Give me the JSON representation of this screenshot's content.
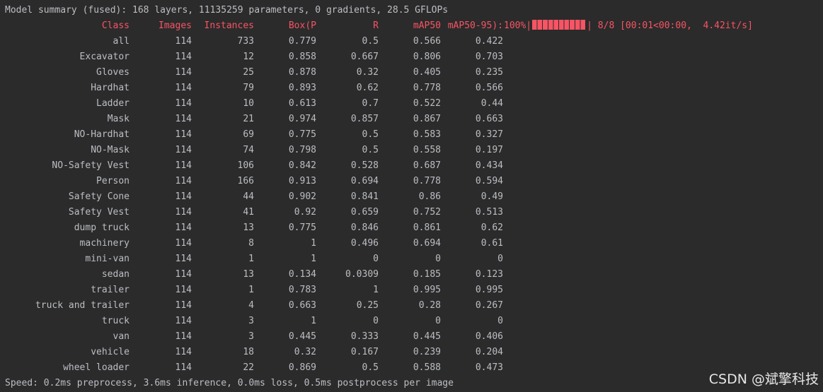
{
  "summary_line": "Model summary (fused): 168 layers, 11135259 parameters, 0 gradients, 28.5 GFLOPs",
  "header": {
    "class": "Class",
    "images": "Images",
    "instances": "Instances",
    "box_p": "Box(P",
    "r": "R",
    "map50": "mAP50",
    "map50_95": "mAP50-95):",
    "progress_pct": "100%|",
    "progress_fraction": 1.0,
    "progress_tail": "| 8/8 [00:01<00:00,  4.42it/s]"
  },
  "rows": [
    {
      "class": "all",
      "images": "114",
      "instances": "733",
      "p": "0.779",
      "r": "0.5",
      "map50": "0.566",
      "map50_95": "0.422"
    },
    {
      "class": "Excavator",
      "images": "114",
      "instances": "12",
      "p": "0.858",
      "r": "0.667",
      "map50": "0.806",
      "map50_95": "0.703"
    },
    {
      "class": "Gloves",
      "images": "114",
      "instances": "25",
      "p": "0.878",
      "r": "0.32",
      "map50": "0.405",
      "map50_95": "0.235"
    },
    {
      "class": "Hardhat",
      "images": "114",
      "instances": "79",
      "p": "0.893",
      "r": "0.62",
      "map50": "0.778",
      "map50_95": "0.566"
    },
    {
      "class": "Ladder",
      "images": "114",
      "instances": "10",
      "p": "0.613",
      "r": "0.7",
      "map50": "0.522",
      "map50_95": "0.44"
    },
    {
      "class": "Mask",
      "images": "114",
      "instances": "21",
      "p": "0.974",
      "r": "0.857",
      "map50": "0.867",
      "map50_95": "0.663"
    },
    {
      "class": "NO-Hardhat",
      "images": "114",
      "instances": "69",
      "p": "0.775",
      "r": "0.5",
      "map50": "0.583",
      "map50_95": "0.327"
    },
    {
      "class": "NO-Mask",
      "images": "114",
      "instances": "74",
      "p": "0.798",
      "r": "0.5",
      "map50": "0.558",
      "map50_95": "0.197"
    },
    {
      "class": "NO-Safety Vest",
      "images": "114",
      "instances": "106",
      "p": "0.842",
      "r": "0.528",
      "map50": "0.687",
      "map50_95": "0.434"
    },
    {
      "class": "Person",
      "images": "114",
      "instances": "166",
      "p": "0.913",
      "r": "0.694",
      "map50": "0.778",
      "map50_95": "0.594"
    },
    {
      "class": "Safety Cone",
      "images": "114",
      "instances": "44",
      "p": "0.902",
      "r": "0.841",
      "map50": "0.86",
      "map50_95": "0.49"
    },
    {
      "class": "Safety Vest",
      "images": "114",
      "instances": "41",
      "p": "0.92",
      "r": "0.659",
      "map50": "0.752",
      "map50_95": "0.513"
    },
    {
      "class": "dump truck",
      "images": "114",
      "instances": "13",
      "p": "0.775",
      "r": "0.846",
      "map50": "0.861",
      "map50_95": "0.62"
    },
    {
      "class": "machinery",
      "images": "114",
      "instances": "8",
      "p": "1",
      "r": "0.496",
      "map50": "0.694",
      "map50_95": "0.61"
    },
    {
      "class": "mini-van",
      "images": "114",
      "instances": "1",
      "p": "1",
      "r": "0",
      "map50": "0",
      "map50_95": "0"
    },
    {
      "class": "sedan",
      "images": "114",
      "instances": "13",
      "p": "0.134",
      "r": "0.0309",
      "map50": "0.185",
      "map50_95": "0.123"
    },
    {
      "class": "trailer",
      "images": "114",
      "instances": "1",
      "p": "0.783",
      "r": "1",
      "map50": "0.995",
      "map50_95": "0.995"
    },
    {
      "class": "truck and trailer",
      "images": "114",
      "instances": "4",
      "p": "0.663",
      "r": "0.25",
      "map50": "0.28",
      "map50_95": "0.267"
    },
    {
      "class": "truck",
      "images": "114",
      "instances": "3",
      "p": "1",
      "r": "0",
      "map50": "0",
      "map50_95": "0"
    },
    {
      "class": "van",
      "images": "114",
      "instances": "3",
      "p": "0.445",
      "r": "0.333",
      "map50": "0.445",
      "map50_95": "0.406"
    },
    {
      "class": "vehicle",
      "images": "114",
      "instances": "18",
      "p": "0.32",
      "r": "0.167",
      "map50": "0.239",
      "map50_95": "0.204"
    },
    {
      "class": "wheel loader",
      "images": "114",
      "instances": "22",
      "p": "0.869",
      "r": "0.5",
      "map50": "0.588",
      "map50_95": "0.473"
    }
  ],
  "speed_line": "Speed: 0.2ms preprocess, 3.6ms inference, 0.0ms loss, 0.5ms postprocess per image",
  "watermark": "CSDN @斌擎科技",
  "colors": {
    "background": "#2b2b2b",
    "text": "#bcbec4",
    "header": "#f75464"
  }
}
